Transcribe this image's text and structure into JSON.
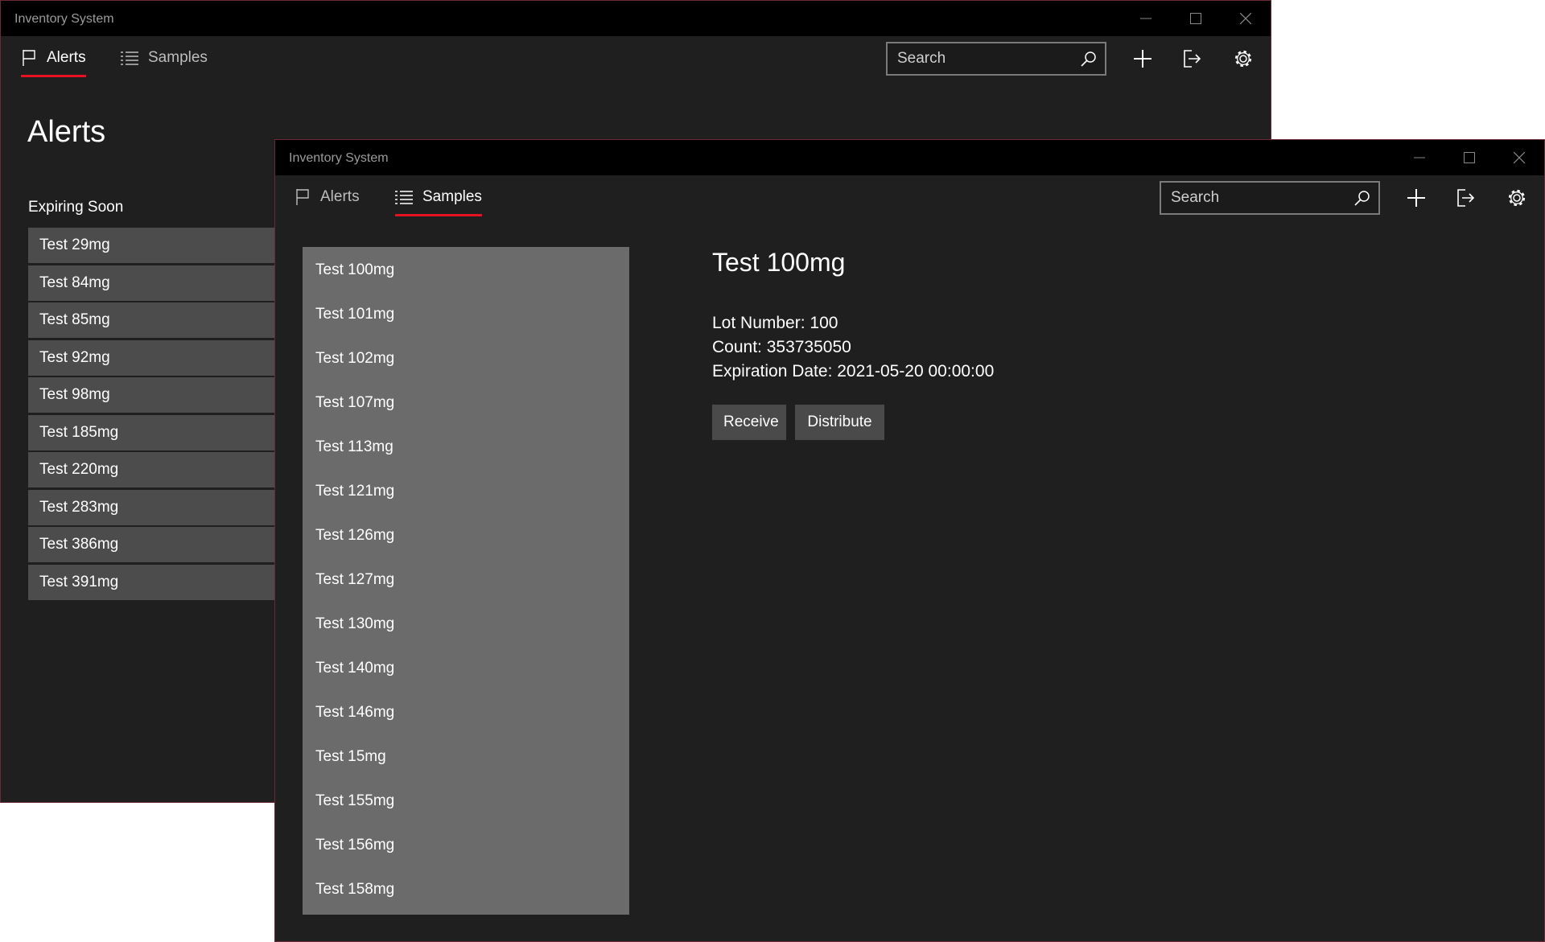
{
  "back_window": {
    "title": "Inventory System",
    "tabs": [
      {
        "label": "Alerts"
      },
      {
        "label": "Samples"
      }
    ],
    "search": {
      "placeholder": "Search",
      "value": ""
    },
    "page_title": "Alerts",
    "section_label": "Expiring Soon",
    "alerts": [
      "Test 29mg",
      "Test 84mg",
      "Test 85mg",
      "Test 92mg",
      "Test 98mg",
      "Test 185mg",
      "Test 220mg",
      "Test 283mg",
      "Test 386mg",
      "Test 391mg"
    ]
  },
  "front_window": {
    "title": "Inventory System",
    "tabs": [
      {
        "label": "Alerts"
      },
      {
        "label": "Samples"
      }
    ],
    "search": {
      "placeholder": "Search",
      "value": ""
    },
    "samples": [
      "Test 100mg",
      "Test 101mg",
      "Test 102mg",
      "Test 107mg",
      "Test 113mg",
      "Test 121mg",
      "Test 126mg",
      "Test 127mg",
      "Test 130mg",
      "Test 140mg",
      "Test 146mg",
      "Test 15mg",
      "Test 155mg",
      "Test 156mg",
      "Test 158mg"
    ],
    "detail": {
      "name": "Test 100mg",
      "lot_number": "Lot Number: 100",
      "count": "Count: 353735050",
      "expiration": "Expiration Date: 2021-05-20 00:00:00",
      "receive_label": "Receive",
      "distribute_label": "Distribute"
    }
  },
  "colors": {
    "accent": "#e81123",
    "background": "#1f1f1f",
    "list_item": "#4c4c4c",
    "sample_list": "#6b6b6b",
    "button": "#4a4a4a"
  },
  "icons": [
    "flag-icon",
    "list-icon",
    "search-icon",
    "plus-icon",
    "sign-out-icon",
    "gear-icon",
    "minimize-icon",
    "maximize-icon",
    "close-icon"
  ]
}
